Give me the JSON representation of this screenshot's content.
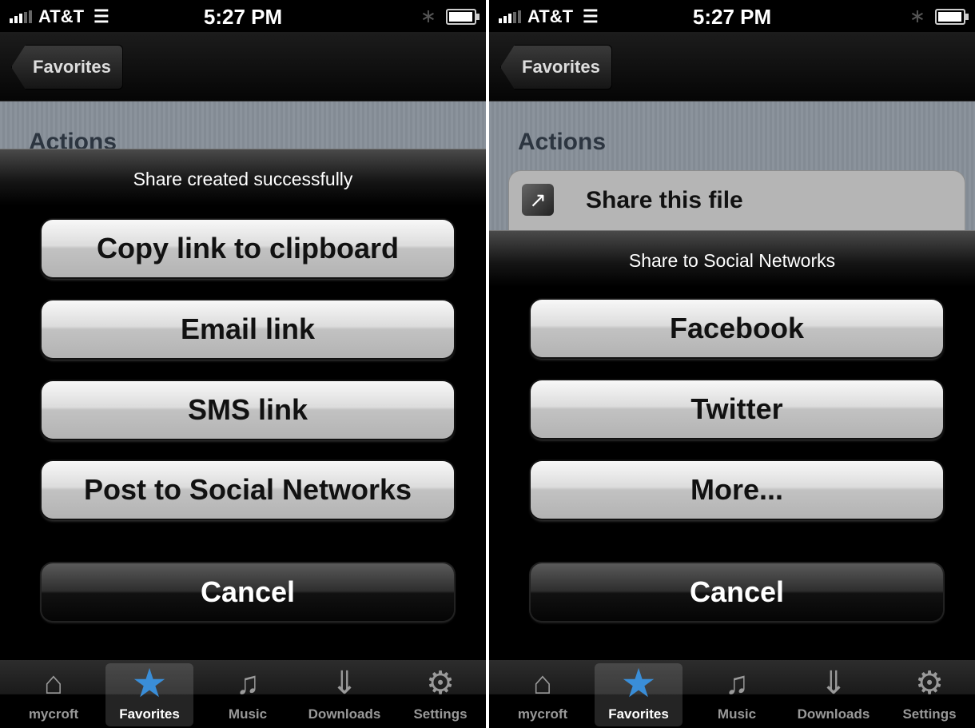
{
  "left": {
    "status": {
      "carrier": "AT&T",
      "time": "5:27 PM"
    },
    "nav": {
      "back_label": "Favorites"
    },
    "content": {
      "section_header": "Actions"
    },
    "sheet": {
      "title": "Share created successfully",
      "buttons": [
        "Copy link to clipboard",
        "Email link",
        "SMS link",
        "Post to Social Networks"
      ],
      "cancel": "Cancel"
    },
    "tabs": [
      "mycroft",
      "Favorites",
      "Music",
      "Downloads",
      "Settings"
    ]
  },
  "right": {
    "status": {
      "carrier": "AT&T",
      "time": "5:27 PM"
    },
    "nav": {
      "back_label": "Favorites"
    },
    "content": {
      "section_header": "Actions",
      "share_row_label": "Share this file"
    },
    "sheet": {
      "title": "Share to Social Networks",
      "buttons": [
        "Facebook",
        "Twitter",
        "More..."
      ],
      "cancel": "Cancel"
    },
    "tabs": [
      "mycroft",
      "Favorites",
      "Music",
      "Downloads",
      "Settings"
    ]
  },
  "selected_tab": "Favorites",
  "colors": {
    "selected_tab_icon": "#3a8ed8",
    "content_bg": "#878f98"
  }
}
